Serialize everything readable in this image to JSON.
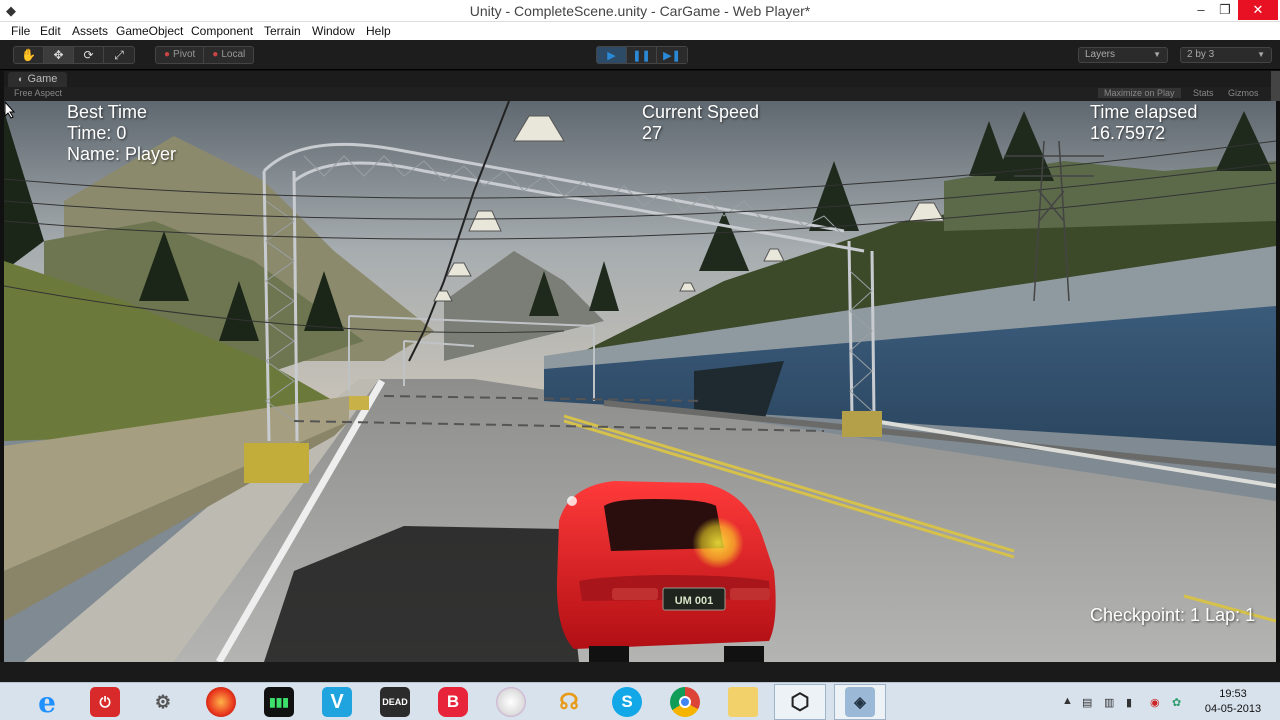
{
  "window": {
    "title": "Unity - CompleteScene.unity - CarGame - Web Player*",
    "icon": "unity-icon",
    "min_glyph": "–",
    "max_glyph": "❐",
    "close_glyph": "✕"
  },
  "menu": [
    "File",
    "Edit",
    "Assets",
    "GameObject",
    "Component",
    "Terrain",
    "Window",
    "Help"
  ],
  "toolbar": {
    "transform_tools": [
      "hand-icon",
      "move-icon",
      "rotate-icon",
      "scale-icon"
    ],
    "pivot_label": "Pivot",
    "local_label": "Local",
    "play_controls": [
      "play-icon",
      "pause-icon",
      "step-icon"
    ],
    "layers_label": "Layers",
    "layout_label": "2 by 3"
  },
  "game_panel": {
    "tab_label": "Game",
    "aspect_label": "Free Aspect",
    "maximize_label": "Maximize on Play",
    "stats_label": "Stats",
    "gizmos_label": "Gizmos"
  },
  "hud": {
    "best_time_title": "Best Time",
    "best_time": "Time: 0",
    "player_name": "Name: Player",
    "speed_title": "Current Speed",
    "speed_value": "27",
    "elapsed_title": "Time elapsed",
    "elapsed_value": "16.75972",
    "checkpoint": "Checkpoint: 1 Lap: 1",
    "license_plate": "UM 001"
  },
  "colors": {
    "car": "#d81a1f",
    "accent": "#2a8ad8",
    "close": "#e81123"
  },
  "taskbar": {
    "apps": [
      "internet-explorer-icon",
      "power-app-icon",
      "media-center-icon",
      "red-app-icon",
      "equalizer-app-icon",
      "vlc-like-icon",
      "the-walking-dead-icon",
      "b-app-icon",
      "chart-app-icon",
      "headphones-app-icon",
      "skype-icon",
      "chrome-icon",
      "folder-icon",
      "unity-icon",
      "web-player-icon"
    ],
    "ie_glyph": "e",
    "power_glyph": "⏻",
    "v_glyph": "V",
    "dead_label": "DEAD",
    "b_glyph": "B",
    "skype_glyph": "S",
    "time": "19:53",
    "date": "04-05-2013"
  }
}
